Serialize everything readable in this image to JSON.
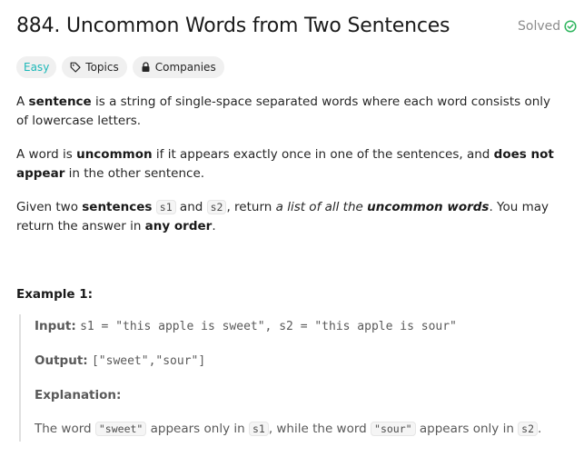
{
  "problem": {
    "title": "884. Uncommon Words from Two Sentences",
    "status": "Solved"
  },
  "tags": {
    "difficulty": "Easy",
    "topics": "Topics",
    "companies": "Companies"
  },
  "description": {
    "p1": {
      "t1": "A ",
      "b1": "sentence",
      "t2": " is a string of single-space separated words where each word consists only of lowercase letters."
    },
    "p2": {
      "t1": "A word is ",
      "b1": "uncommon",
      "t2": " if it appears exactly once in one of the sentences, and ",
      "b2": "does not appear",
      "t3": " in the other sentence."
    },
    "p3": {
      "t1": "Given two ",
      "b1": "sentences",
      "c1": "s1",
      "t2": " and ",
      "c2": "s2",
      "t3": ", return ",
      "i1": "a list of all the ",
      "ib1": "uncommon words",
      "t4": ". You may return the answer in ",
      "b2": "any order",
      "t5": "."
    }
  },
  "example": {
    "title": "Example 1:",
    "input_label": "Input:",
    "input_value": "s1 = \"this apple is sweet\", s2 = \"this apple is sour\"",
    "output_label": "Output:",
    "output_value": "[\"sweet\",\"sour\"]",
    "explanation_label": "Explanation:",
    "explanation": {
      "t1": "The word ",
      "c1": "\"sweet\"",
      "t2": " appears only in ",
      "c2": "s1",
      "t3": ", while the word ",
      "c3": "\"sour\"",
      "t4": " appears only in ",
      "c4": "s2",
      "t5": "."
    }
  },
  "colors": {
    "easy": "#1cb8b8",
    "solved_icon": "#2db55d",
    "tag_bg": "#f0f0f0"
  },
  "icons": {
    "solved": "check-circle-icon",
    "topics": "tag-icon",
    "companies": "lock-icon"
  }
}
